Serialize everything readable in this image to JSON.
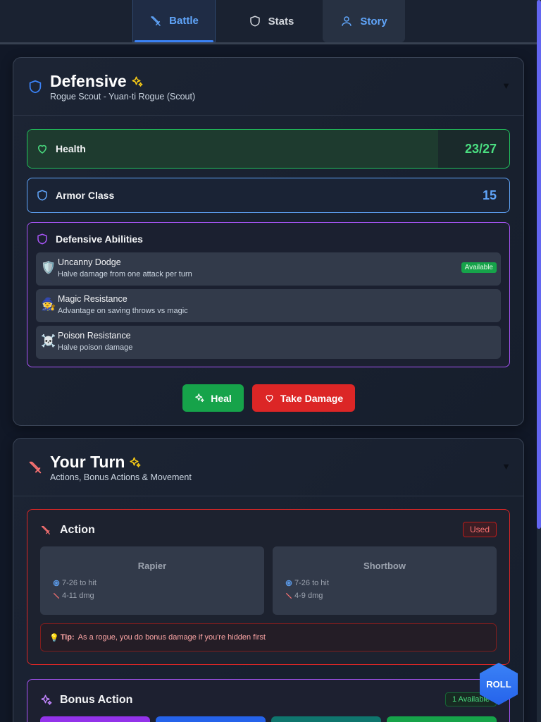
{
  "tabs": [
    {
      "label": "Battle",
      "icon": "sword-icon",
      "active": true
    },
    {
      "label": "Stats",
      "icon": "shield-icon"
    },
    {
      "label": "Story",
      "icon": "user-icon"
    }
  ],
  "defensive": {
    "title": "Defensive",
    "subtitle": "Rogue Scout - Yuan-ti Rogue (Scout)",
    "health": {
      "label": "Health",
      "value": "23/27",
      "fraction": 0.852
    },
    "armor": {
      "label": "Armor Class",
      "value": "15"
    },
    "abilities": {
      "title": "Defensive Abilities",
      "items": [
        {
          "icon": "🛡️",
          "name": "Uncanny Dodge",
          "desc": "Halve damage from one attack per turn",
          "badge": "Available"
        },
        {
          "icon": "🧙",
          "name": "Magic Resistance",
          "desc": "Advantage on saving throws vs magic"
        },
        {
          "icon": "☠️",
          "name": "Poison Resistance",
          "desc": "Halve poison damage"
        }
      ]
    },
    "heal_label": "Heal",
    "damage_label": "Take Damage"
  },
  "turn": {
    "title": "Your Turn",
    "subtitle": "Actions, Bonus Actions & Movement",
    "action": {
      "title": "Action",
      "status": "Used",
      "weapons": [
        {
          "name": "Rapier",
          "hit": "7-26 to hit",
          "dmg": "4-11 dmg"
        },
        {
          "name": "Shortbow",
          "hit": "7-26 to hit",
          "dmg": "4-9 dmg"
        }
      ],
      "tip_label": "Tip:",
      "tip_text": "As a rogue, you do bonus damage if you're hidden first"
    },
    "bonus": {
      "title": "Bonus Action",
      "status": "1 Available",
      "chip_colors": [
        "#9333ea",
        "#2563eb",
        "#0f766e",
        "#16a34a"
      ]
    }
  },
  "roll_label": "ROLL",
  "colors": {
    "accent": "#3b82f6",
    "health": "#22c55e",
    "danger": "#dc2626",
    "magic": "#a855f7"
  }
}
